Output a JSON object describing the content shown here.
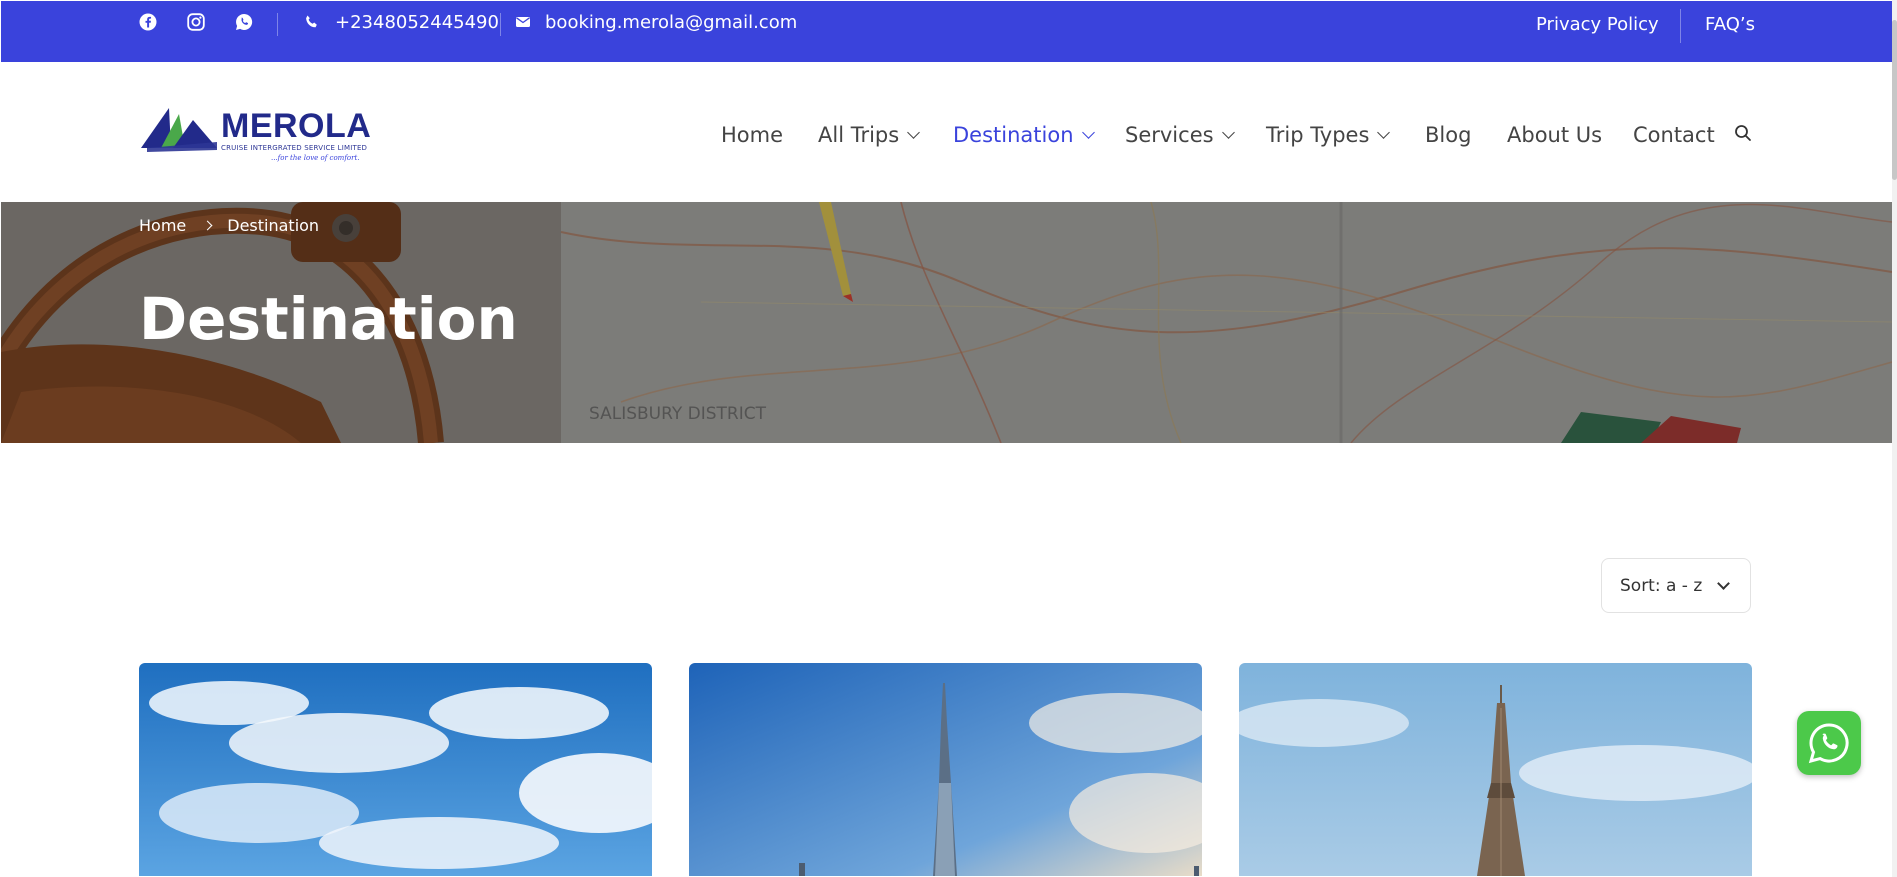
{
  "topbar": {
    "phone": "+2348052445490",
    "email": "booking.merola@gmail.com",
    "links": [
      "Privacy Policy",
      "FAQ’s"
    ],
    "social_icons": [
      "facebook-icon",
      "instagram-icon",
      "whatsapp-icon"
    ],
    "bg_color": "#3a43dc"
  },
  "logo": {
    "name": "MEROLA",
    "subtitle": "CRUISE INTERGRATED SERVICE LIMITED",
    "tagline": "...for the love of comfort."
  },
  "nav": {
    "items": [
      {
        "label": "Home",
        "dropdown": false,
        "active": false
      },
      {
        "label": "All Trips",
        "dropdown": true,
        "active": false
      },
      {
        "label": "Destination",
        "dropdown": true,
        "active": true
      },
      {
        "label": "Services",
        "dropdown": true,
        "active": false
      },
      {
        "label": "Trip Types",
        "dropdown": true,
        "active": false
      },
      {
        "label": "Blog",
        "dropdown": false,
        "active": false
      },
      {
        "label": "About Us",
        "dropdown": false,
        "active": false
      },
      {
        "label": "Contact",
        "dropdown": false,
        "active": false
      }
    ],
    "search_icon": "search-icon",
    "accent_color": "#3a43dc"
  },
  "hero": {
    "breadcrumb": [
      "Home",
      "Destination"
    ],
    "title": "Destination",
    "map_label": "SALISBURY DISTRICT"
  },
  "sort": {
    "label": "Sort: a - z"
  },
  "cards": [
    {
      "image": "sky-with-clouds"
    },
    {
      "image": "burj-khalifa-skyline"
    },
    {
      "image": "eiffel-tower"
    }
  ],
  "floating": {
    "whatsapp_icon": "whatsapp-icon",
    "color": "#4cc94a"
  }
}
